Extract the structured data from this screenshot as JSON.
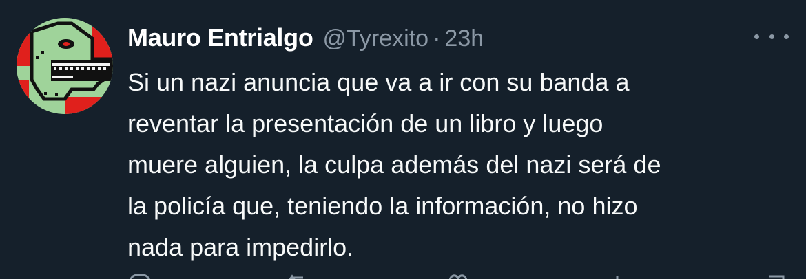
{
  "tweet": {
    "author": {
      "display_name": "Mauro Entrialgo",
      "handle": "@Tyrexito",
      "avatar_icon": "pixel-dinosaur-avatar"
    },
    "separator": "·",
    "timestamp": "23h",
    "text_lines": [
      "Si un nazi anuncia que va a ir con su banda a",
      "reventar la presentación de un libro y luego",
      "muere alguien, la culpa además del nazi será de",
      "la policía que, teniendo la información, no hizo",
      "nada para impedirlo."
    ],
    "actions": [
      "reply-icon",
      "retweet-icon",
      "like-icon",
      "views-icon",
      "bookmark-icon"
    ]
  },
  "colors": {
    "background": "#15202b",
    "text": "#f7f9f9",
    "secondary": "#8b98a5",
    "avatar_green": "#9fd39a",
    "avatar_red": "#e0201c"
  }
}
